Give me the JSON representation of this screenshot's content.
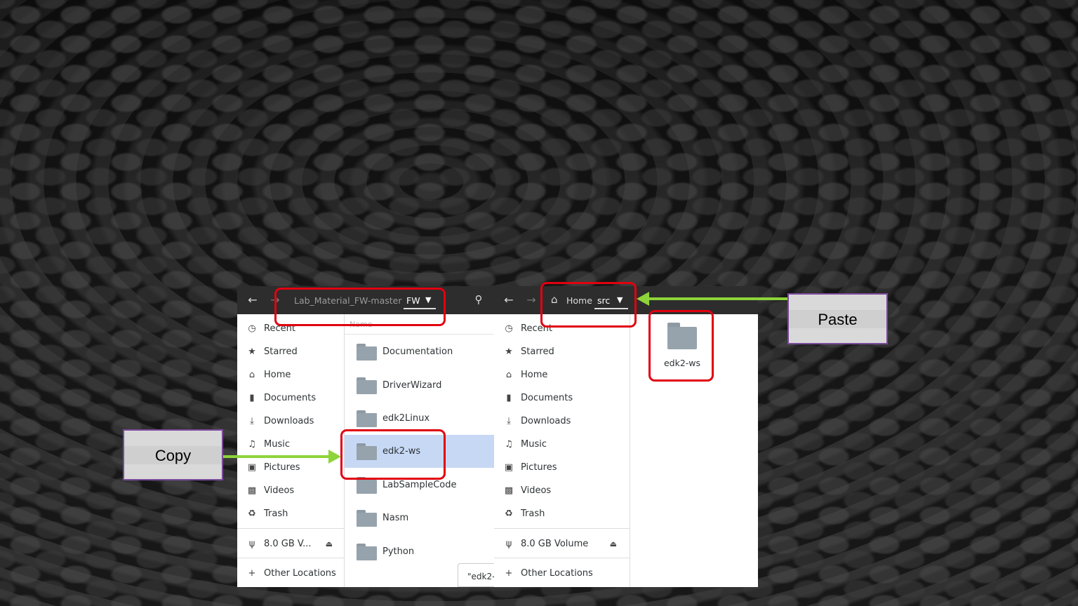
{
  "left_window": {
    "path_parent": "Lab_Material_FW-master",
    "path_current": "FW",
    "column_header": "Name",
    "sidebar": [
      {
        "icon": "clock-icon",
        "label": "Recent"
      },
      {
        "icon": "star-icon",
        "label": "Starred"
      },
      {
        "icon": "home-icon",
        "label": "Home"
      },
      {
        "icon": "document-icon",
        "label": "Documents"
      },
      {
        "icon": "download-icon",
        "label": "Downloads"
      },
      {
        "icon": "music-icon",
        "label": "Music"
      },
      {
        "icon": "picture-icon",
        "label": "Pictures"
      },
      {
        "icon": "video-icon",
        "label": "Videos"
      },
      {
        "icon": "trash-icon",
        "label": "Trash"
      }
    ],
    "volume_label": "8.0 GB V...",
    "other_locations": "Other Locations",
    "files": [
      "Documentation",
      "DriverWizard",
      "edk2Linux",
      "edk2-ws",
      "LabSampleCode",
      "Nasm",
      "Python"
    ],
    "selected_file": "edk2-ws",
    "status_tooltip": "\"edk2-"
  },
  "right_window": {
    "path_home": "Home",
    "path_current": "src",
    "sidebar": [
      {
        "icon": "clock-icon",
        "label": "Recent"
      },
      {
        "icon": "star-icon",
        "label": "Starred"
      },
      {
        "icon": "home-icon",
        "label": "Home"
      },
      {
        "icon": "document-icon",
        "label": "Documents"
      },
      {
        "icon": "download-icon",
        "label": "Downloads"
      },
      {
        "icon": "music-icon",
        "label": "Music"
      },
      {
        "icon": "picture-icon",
        "label": "Pictures"
      },
      {
        "icon": "video-icon",
        "label": "Videos"
      },
      {
        "icon": "trash-icon",
        "label": "Trash"
      }
    ],
    "volume_label": "8.0 GB Volume",
    "other_locations": "Other Locations",
    "icon_item": "edk2-ws"
  },
  "callouts": {
    "copy": "Copy",
    "paste": "Paste"
  },
  "colors": {
    "highlight": "#e10010",
    "arrow": "#8dd43a",
    "selection": "#c7d8f5",
    "headerbar": "#2d2d2d"
  }
}
